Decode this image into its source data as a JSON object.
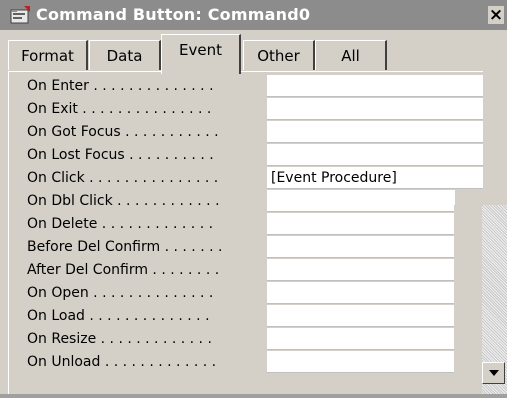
{
  "window": {
    "title": "Command Button: Command0",
    "close_label": "×"
  },
  "tabs": [
    {
      "label": "Format",
      "active": false
    },
    {
      "label": "Data",
      "active": false
    },
    {
      "label": "Event",
      "active": true
    },
    {
      "label": "Other",
      "active": false
    },
    {
      "label": "All",
      "active": false
    }
  ],
  "properties": [
    {
      "label": "On Enter . . . . . . . . . . . . . .",
      "value": ""
    },
    {
      "label": "On Exit . . . . . . . . . . . . . . .",
      "value": ""
    },
    {
      "label": "On Got Focus . . . . . . . . . . .",
      "value": ""
    },
    {
      "label": "On Lost Focus . . . . . . . . . .",
      "value": ""
    },
    {
      "label": "On Click . . . . . . . . . . . . . . .",
      "value": "[Event Procedure]"
    },
    {
      "label": "On Dbl Click . . . . . . . . . . . .",
      "value": ""
    },
    {
      "label": "On Delete . . . . . . . . . . . . .",
      "value": ""
    },
    {
      "label": "Before Del Confirm . . . . . . .",
      "value": ""
    },
    {
      "label": "After Del Confirm . . . . . . . .",
      "value": ""
    },
    {
      "label": "On Open . . . . . . . . . . . . . .",
      "value": ""
    },
    {
      "label": "On Load . . . . . . . . . . . . . .",
      "value": ""
    },
    {
      "label": "On Resize . . . . . . . . . . . . .",
      "value": ""
    },
    {
      "label": "On Unload . . . . . . . . . . . . .",
      "value": ""
    }
  ],
  "icons": {
    "title": "form-properties-icon",
    "scroll_down": "triangle-down-icon"
  }
}
